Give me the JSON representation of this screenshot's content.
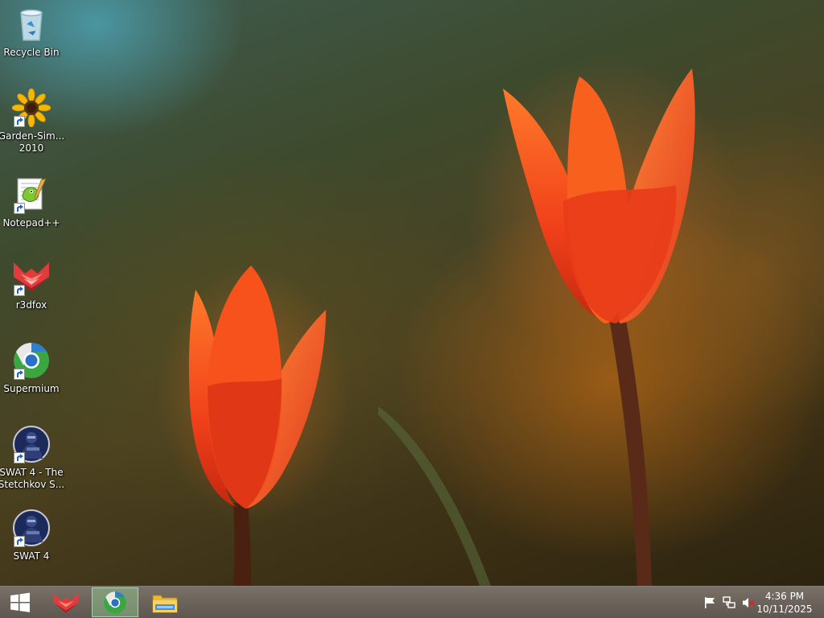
{
  "desktop": {
    "icons": [
      {
        "id": "recycle-bin",
        "label": "Recycle Bin",
        "icon": "recycle-bin-icon",
        "shortcut": false
      },
      {
        "id": "garden-sim",
        "label": "Garden-Sim... 2010",
        "label_lines": [
          "Garden-Sim...",
          "2010"
        ],
        "icon": "sunflower-icon",
        "shortcut": true
      },
      {
        "id": "notepadpp",
        "label": "Notepad++",
        "icon": "notepad-plus-plus-icon",
        "shortcut": true
      },
      {
        "id": "r3dfox",
        "label": "r3dfox",
        "icon": "r3dfox-icon",
        "shortcut": true
      },
      {
        "id": "supermium",
        "label": "Supermium",
        "icon": "supermium-icon",
        "shortcut": true
      },
      {
        "id": "swat4-stetchkov",
        "label_lines": [
          "SWAT 4 - The",
          "Stetchkov S..."
        ],
        "icon": "swat-icon",
        "shortcut": true
      },
      {
        "id": "swat4",
        "label": "SWAT 4",
        "icon": "swat-icon",
        "shortcut": true
      }
    ],
    "wallpaper": "red-tulips-wallpaper"
  },
  "taskbar": {
    "start_icon": "windows-logo-icon",
    "pinned": [
      {
        "id": "r3dfox",
        "icon": "r3dfox-icon",
        "active": false
      },
      {
        "id": "supermium",
        "icon": "supermium-icon",
        "active": true
      },
      {
        "id": "file-explorer",
        "icon": "folder-icon",
        "active": false
      }
    ],
    "tray": [
      {
        "icon": "action-center-flag-icon"
      },
      {
        "icon": "network-icon"
      },
      {
        "icon": "volume-muted-icon"
      }
    ],
    "clock": {
      "time": "4:36 PM",
      "date": "10/11/2025"
    }
  },
  "colors": {
    "taskbar": "#5f574f",
    "active_task": "#8cbe8c",
    "tulip": "#f04a14"
  }
}
